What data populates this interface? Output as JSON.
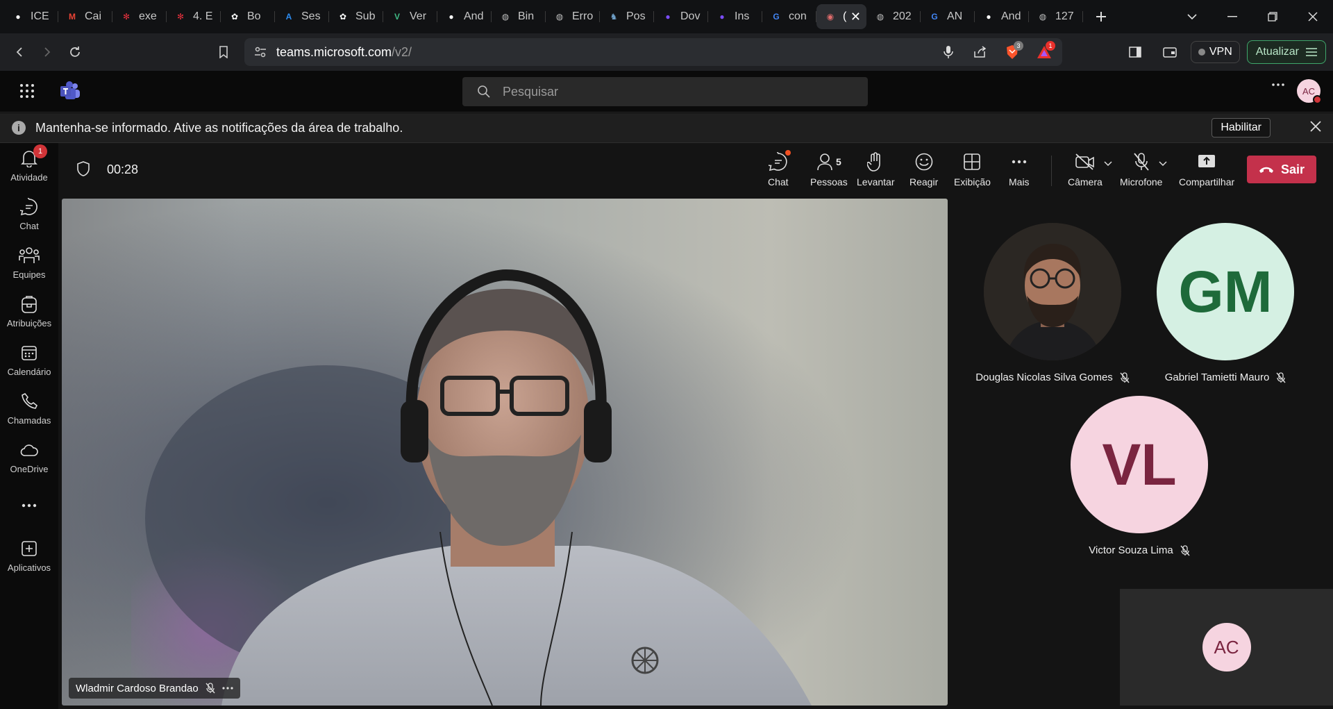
{
  "browser": {
    "tabs": [
      {
        "title": "ICE",
        "icon": "github-icon",
        "color": "#ffffff"
      },
      {
        "title": "Cai",
        "icon": "gmail-icon",
        "color": "#ea4335"
      },
      {
        "title": "exe",
        "icon": "gear-icon",
        "color": "#e0303c"
      },
      {
        "title": "4. E",
        "icon": "gear-icon",
        "color": "#e0303c"
      },
      {
        "title": "Bo",
        "icon": "openai-icon",
        "color": "#ffffff"
      },
      {
        "title": "Ses",
        "icon": "azure-icon",
        "color": "#2d8cf0"
      },
      {
        "title": "Sub",
        "icon": "openai-icon",
        "color": "#ffffff"
      },
      {
        "title": "Ver",
        "icon": "vue-icon",
        "color": "#3fb984"
      },
      {
        "title": "And",
        "icon": "github-icon",
        "color": "#ffffff"
      },
      {
        "title": "Bin",
        "icon": "globe-icon",
        "color": "#bfbfbf"
      },
      {
        "title": "Erro",
        "icon": "globe-icon",
        "color": "#bfbfbf"
      },
      {
        "title": "Pos",
        "icon": "postgres-icon",
        "color": "#6fa0c8"
      },
      {
        "title": "Dov",
        "icon": "circle-icon",
        "color": "#7c4dff"
      },
      {
        "title": "Ins",
        "icon": "circle-icon",
        "color": "#7c4dff"
      },
      {
        "title": "con",
        "icon": "google-icon",
        "color": "#4285f4"
      },
      {
        "title": "(",
        "icon": "record-icon",
        "color": "#e06c6c",
        "active": true
      },
      {
        "title": "202",
        "icon": "globe-icon",
        "color": "#bfbfbf"
      },
      {
        "title": "AN",
        "icon": "google-icon",
        "color": "#4285f4"
      },
      {
        "title": "And",
        "icon": "github-icon",
        "color": "#ffffff"
      },
      {
        "title": "127",
        "icon": "globe-icon",
        "color": "#bfbfbf"
      }
    ],
    "url_host": "teams.microsoft.com",
    "url_path": "/v2/",
    "brave_badge": "3",
    "alert_badge": "1",
    "vpn_label": "VPN",
    "update_label": "Atualizar"
  },
  "teams": {
    "search_placeholder": "Pesquisar",
    "user_initials": "AC",
    "notification": {
      "message": "Mantenha-se informado. Ative as notificações da área de trabalho.",
      "enable_label": "Habilitar"
    },
    "rail": [
      {
        "label": "Atividade",
        "icon": "bell-icon",
        "badge": "1"
      },
      {
        "label": "Chat",
        "icon": "chat-icon"
      },
      {
        "label": "Equipes",
        "icon": "teams-people-icon"
      },
      {
        "label": "Atribuições",
        "icon": "backpack-icon"
      },
      {
        "label": "Calendário",
        "icon": "calendar-icon"
      },
      {
        "label": "Chamadas",
        "icon": "phone-icon"
      },
      {
        "label": "OneDrive",
        "icon": "cloud-icon"
      },
      {
        "label": "",
        "icon": "more-icon"
      },
      {
        "label": "Aplicativos",
        "icon": "add-app-icon"
      }
    ]
  },
  "meeting": {
    "timer": "00:28",
    "controls": {
      "chat": "Chat",
      "people": "Pessoas",
      "people_count": "5",
      "raise": "Levantar",
      "react": "Reagir",
      "view": "Exibição",
      "more": "Mais",
      "camera": "Câmera",
      "mic": "Microfone",
      "share": "Compartilhar",
      "leave": "Sair"
    },
    "main_speaker": "Wladmir Cardoso Brandao",
    "participants": [
      {
        "name": "Douglas Nicolas Silva Gomes",
        "initials": "",
        "photo": true
      },
      {
        "name": "Gabriel Tamietti Mauro",
        "initials": "GM",
        "bg": "#d5f0e3",
        "fg": "#1e6a3a"
      },
      {
        "name": "Victor Souza Lima",
        "initials": "VL",
        "bg": "#f6d4e0",
        "fg": "#7a2540"
      }
    ],
    "self_initials": "AC"
  }
}
